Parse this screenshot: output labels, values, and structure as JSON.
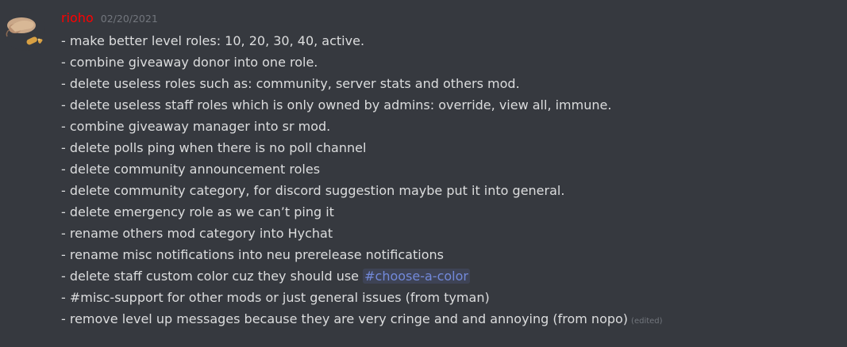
{
  "message": {
    "author": {
      "username": "rioho",
      "color": "#ff0000"
    },
    "timestamp": "02/20/2021",
    "lines": [
      "- make better level roles: 10, 20, 30, 40, active.",
      "- combine giveaway donor into one role.",
      "- delete useless roles such as: community, server stats and others mod.",
      "- delete useless staff roles which is only owned by admins: override, view all, immune.",
      "- combine giveaway manager into sr mod.",
      "- delete polls ping when there is no poll channel",
      "- delete community announcement roles",
      "- delete community category, for discord suggestion maybe put it into general.",
      "- delete emergency role as we can’t ping it",
      "- rename others mod category into Hychat",
      "- rename misc notifications into neu prerelease notifications"
    ],
    "line_with_mention": {
      "prefix": "- delete staff custom color cuz they should use ",
      "channel_mention": "#choose-a-color"
    },
    "line_13": "- #misc-support for other mods or just general issues (from tyman)",
    "last_line": "-  remove level up messages because they are very cringe and and annoying (from nopo)",
    "edited_label": "(edited)"
  },
  "colors": {
    "background": "#36393f",
    "text": "#dcddde",
    "muted": "#72767d",
    "mention": "#7289da"
  }
}
